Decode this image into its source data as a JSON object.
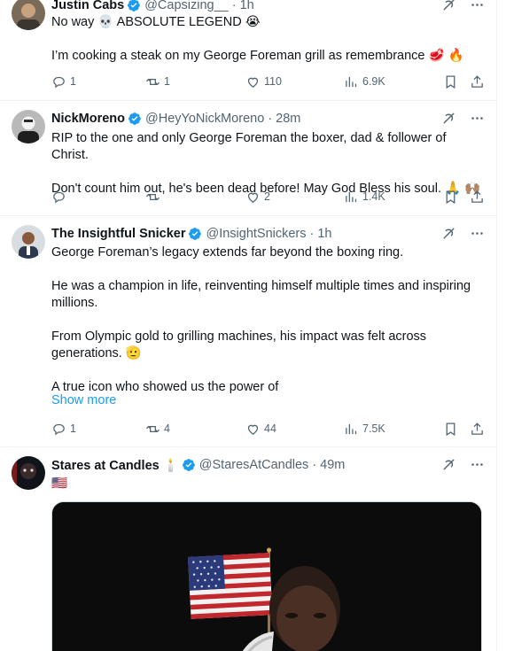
{
  "colors": {
    "accent": "#1d9bf0",
    "secondary_text": "#536471",
    "primary_text": "#0f1419"
  },
  "icons": {
    "grok": "grok-icon",
    "more": "more-icon",
    "reply": "reply-icon",
    "retweet": "retweet-icon",
    "like": "like-icon",
    "views": "views-icon",
    "bookmark": "bookmark-icon",
    "share": "share-icon",
    "verified": "verified-badge-icon"
  },
  "tweets": [
    {
      "name": "Justin Cabs",
      "handle": "@Capsizing__",
      "time": "1h",
      "lines": [
        "No way 💀 ABSOLUTE LEGEND 😭",
        "I’m cooking a steak on my George Foreman grill as remembrance 🥩 🔥"
      ],
      "replies": "1",
      "retweets": "1",
      "likes": "110",
      "views": "6.9K"
    },
    {
      "name": "NickMoreno",
      "handle": "@HeyYoNickMoreno",
      "time": "28m",
      "lines": [
        "RIP to the one and only George Foreman the boxer, dad & follower of Christ.",
        "Don't count him out, he's been dead before! May God Bless his soul. 🙏 🙌🏽"
      ],
      "replies": "",
      "retweets": "",
      "likes": "2",
      "views": "1.4K"
    },
    {
      "name": "The Insightful Snicker",
      "handle": "@InsightSnickers",
      "time": "1h",
      "lines": [
        "George Foreman’s legacy extends far beyond the boxing ring.",
        "He was a champion in life, reinventing himself multiple times and inspiring millions.",
        "From Olympic gold to grilling machines, his impact was felt across generations. 🫡",
        "A true icon who showed us the power of"
      ],
      "show_more": "Show more",
      "replies": "1",
      "retweets": "4",
      "likes": "44",
      "views": "7.5K"
    },
    {
      "name": "Stares at Candles 🕯️",
      "handle": "@StaresAtCandles",
      "time": "49m",
      "lines": [
        "🇺🇸"
      ]
    }
  ]
}
